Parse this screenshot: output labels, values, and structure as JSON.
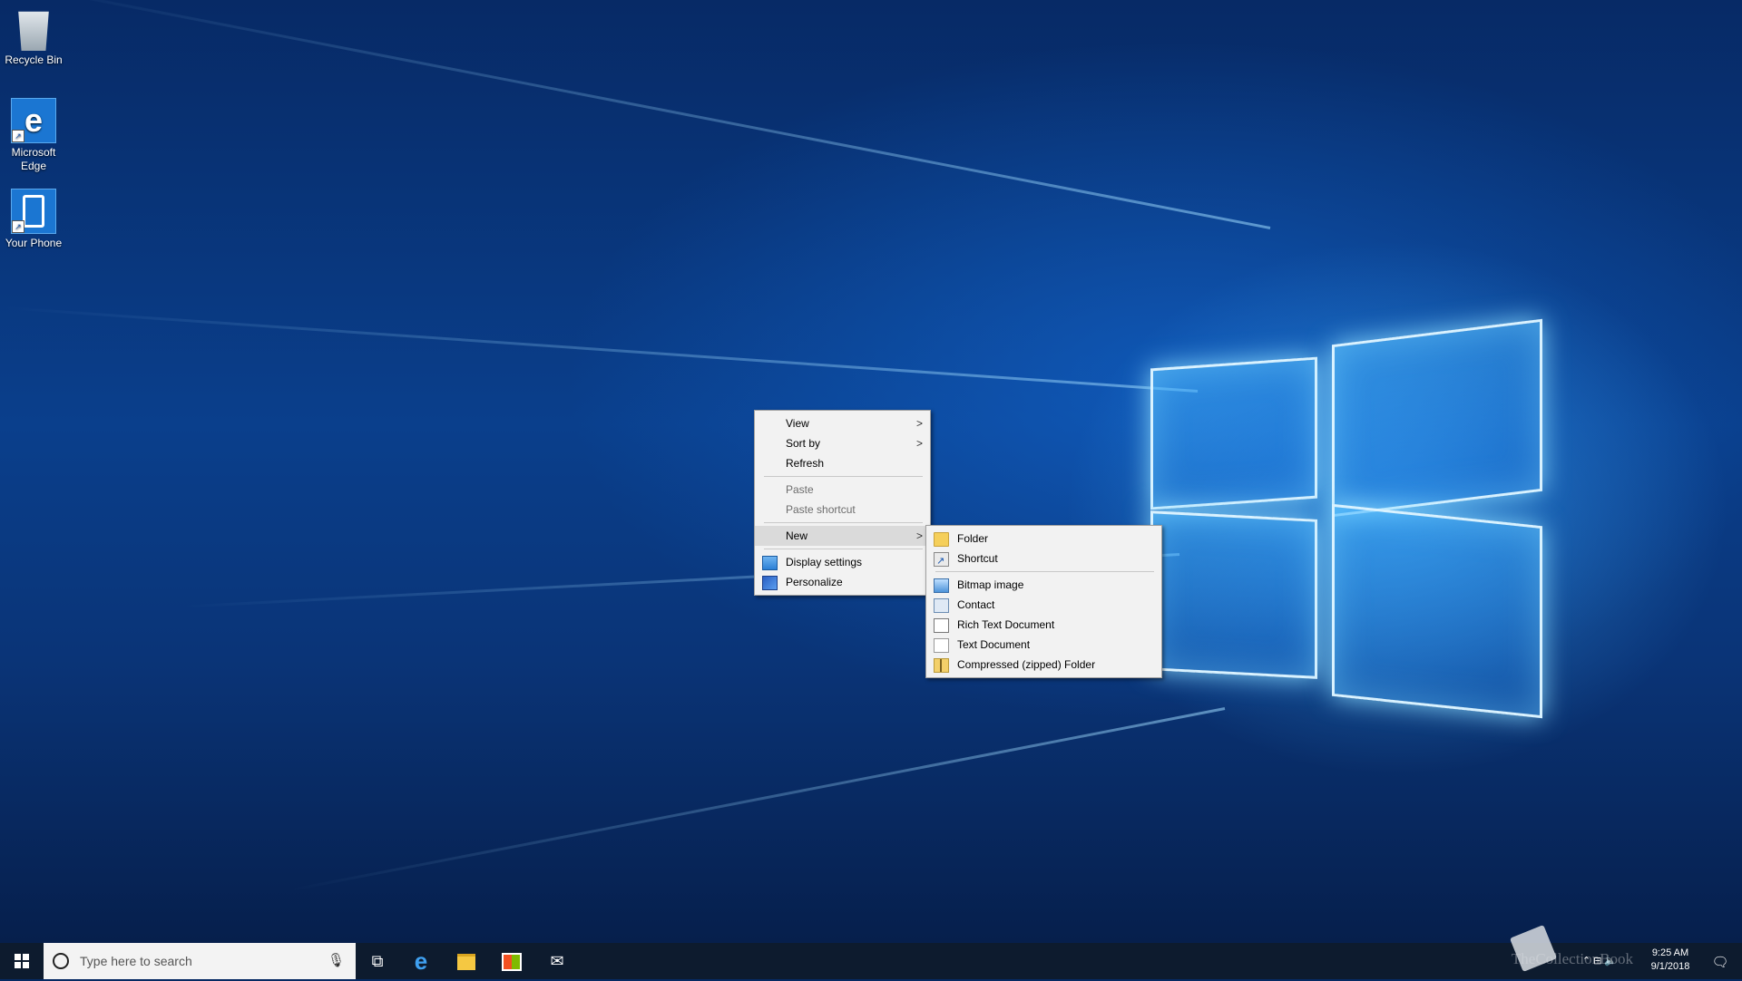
{
  "desktop": {
    "icons": [
      {
        "label": "Recycle Bin",
        "icon": "recycle-bin-icon"
      },
      {
        "label": "Microsoft Edge",
        "icon": "edge-icon"
      },
      {
        "label": "Your Phone",
        "icon": "phone-icon"
      }
    ]
  },
  "context_menu": {
    "items": [
      {
        "label": "View",
        "has_submenu": true
      },
      {
        "label": "Sort by",
        "has_submenu": true
      },
      {
        "label": "Refresh"
      },
      {
        "label": "Paste",
        "disabled": true
      },
      {
        "label": "Paste shortcut",
        "disabled": true
      },
      {
        "label": "New",
        "has_submenu": true,
        "active": true
      },
      {
        "label": "Display settings",
        "icon": "display-icon"
      },
      {
        "label": "Personalize",
        "icon": "personalize-icon"
      }
    ],
    "arrow": ">"
  },
  "new_submenu": {
    "items": [
      {
        "label": "Folder",
        "icon": "folder-icon"
      },
      {
        "label": "Shortcut",
        "icon": "shortcut-icon"
      },
      {
        "label": "Bitmap image",
        "icon": "bitmap-icon"
      },
      {
        "label": "Contact",
        "icon": "contact-icon"
      },
      {
        "label": "Rich Text Document",
        "icon": "rtf-icon"
      },
      {
        "label": "Text Document",
        "icon": "text-document-icon"
      },
      {
        "label": "Compressed (zipped) Folder",
        "icon": "zip-folder-icon"
      }
    ]
  },
  "taskbar": {
    "search_placeholder": "Type here to search",
    "pinned": [
      "task-view-icon",
      "edge-icon",
      "file-explorer-icon",
      "store-icon",
      "mail-icon"
    ],
    "clock_time": "9:25 AM",
    "clock_date": "9/1/2018",
    "watermark": "TheCollectionBook"
  },
  "colors": {
    "taskbar": "#0d1b2e",
    "menu_bg": "#f2f2f2",
    "menu_active": "#dadada",
    "accent": "#0078d7"
  }
}
